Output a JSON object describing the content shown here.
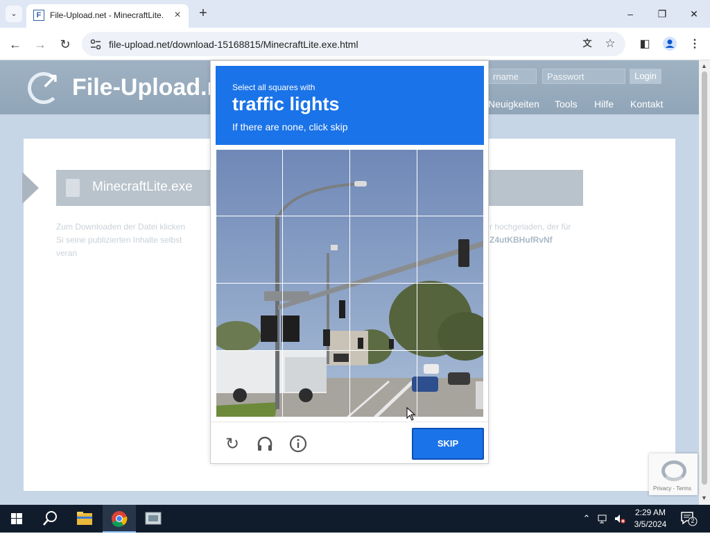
{
  "browser": {
    "tab_title": "File-Upload.net - MinecraftLite.",
    "tab_favicon": "F",
    "url": "file-upload.net/download-15168815/MinecraftLite.exe.html",
    "icons": [
      "tab-list-icon",
      "close-icon",
      "plus-icon",
      "minimize-icon",
      "restore-icon",
      "close-window-icon",
      "back-arrow-icon",
      "forward-arrow-icon",
      "reload-icon",
      "site-info-icon",
      "translate-icon",
      "star-icon",
      "side-panel-icon",
      "profile-icon",
      "menu-dots-icon"
    ]
  },
  "site": {
    "logo": "File-Upload.n",
    "login": {
      "username_placeholder": "rname",
      "password_placeholder": "Passwort",
      "button": "Login"
    },
    "nav": [
      "Neuigkeiten",
      "Tools",
      "Hilfe",
      "Kontakt"
    ],
    "file_name": "MinecraftLite.exe",
    "info_left": "Zum Downloaden der Datei klicken Si seine publizierten Inhalte selbst veran",
    "info_right_1": "r hochgeladen, der für",
    "info_right_2": "Z4utKBHufRvNf"
  },
  "captcha": {
    "header_line1": "Select all squares with",
    "header_line2": "traffic lights",
    "header_line3": "If there are none, click skip",
    "skip_label": "SKIP",
    "footer_icons": [
      "reload-icon",
      "headphones-icon",
      "info-icon"
    ]
  },
  "recaptcha_badge": {
    "terms": "Privacy - Terms"
  },
  "taskbar": {
    "time": "2:29 AM",
    "date": "3/5/2024",
    "notification_count": "2"
  }
}
